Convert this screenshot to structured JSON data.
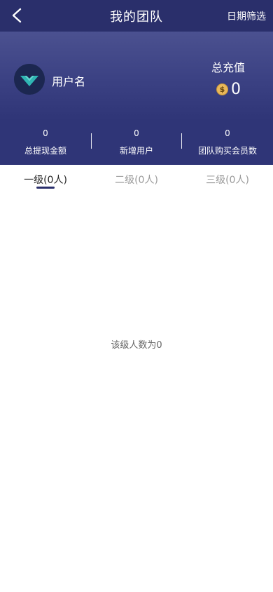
{
  "header": {
    "title": "我的团队",
    "right_action": "日期筛选"
  },
  "profile": {
    "username": "用户名",
    "recharge_label": "总充值",
    "recharge_value": "0"
  },
  "stats": [
    {
      "value": "0",
      "label": "总提现金额"
    },
    {
      "value": "0",
      "label": "新增用户"
    },
    {
      "value": "0",
      "label": "团队购买会员数"
    }
  ],
  "tabs": [
    {
      "label": "一级(0人)"
    },
    {
      "label": "二级(0人)"
    },
    {
      "label": "三级(0人)"
    }
  ],
  "empty_message": "该级人数为0",
  "colors": {
    "header": "#2a2f6b",
    "hero_top": "#4b5190",
    "stats_bg": "#2f3577",
    "accent": "#2a2f6b",
    "coin": "#e9b85a"
  }
}
